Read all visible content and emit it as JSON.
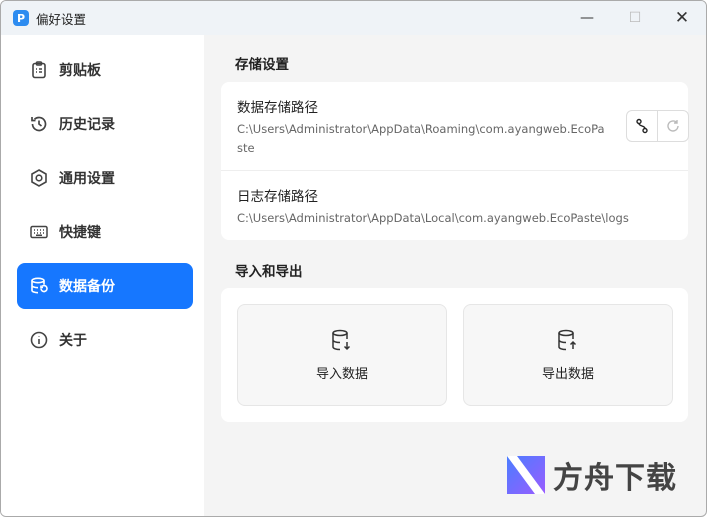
{
  "window": {
    "title": "偏好设置"
  },
  "sidebar": {
    "items": [
      {
        "label": "剪贴板",
        "icon": "clipboard-icon"
      },
      {
        "label": "历史记录",
        "icon": "history-icon"
      },
      {
        "label": "通用设置",
        "icon": "settings-icon"
      },
      {
        "label": "快捷键",
        "icon": "keyboard-icon"
      },
      {
        "label": "数据备份",
        "icon": "database-backup-icon",
        "active": true
      },
      {
        "label": "关于",
        "icon": "info-icon"
      }
    ]
  },
  "storage": {
    "heading": "存储设置",
    "data_path_label": "数据存储路径",
    "data_path": "C:\\Users\\Administrator\\AppData\\Roaming\\com.ayangweb.EcoPaste",
    "log_path_label": "日志存储路径",
    "log_path": "C:\\Users\\Administrator\\AppData\\Local\\com.ayangweb.EcoPaste\\logs"
  },
  "io": {
    "heading": "导入和导出",
    "import_label": "导入数据",
    "export_label": "导出数据"
  },
  "watermark": {
    "text": "方舟下载"
  },
  "colors": {
    "accent": "#1677ff"
  }
}
